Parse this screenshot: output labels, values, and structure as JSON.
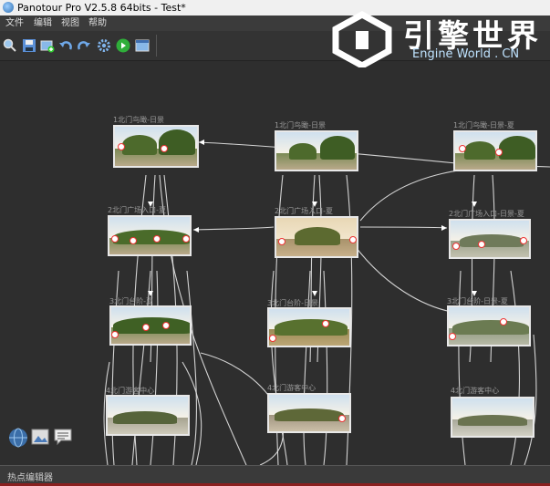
{
  "window": {
    "title": "Panotour Pro V2.5.8 64bits - Test*"
  },
  "menu": [
    "文件",
    "编辑",
    "视图",
    "帮助"
  ],
  "toolbar": [
    {
      "icon": "magnify-icon"
    },
    {
      "icon": "save-icon"
    },
    {
      "icon": "add-panorama-icon"
    },
    {
      "icon": "undo-icon"
    },
    {
      "icon": "redo-icon"
    },
    {
      "icon": "settings-gear-icon"
    },
    {
      "icon": "play-build-icon"
    },
    {
      "icon": "preview-window-icon"
    }
  ],
  "watermark": {
    "cn": "引擎世界",
    "en": "Engine World . CN"
  },
  "nodes": [
    {
      "label": "1北门鸟瞰-日景"
    },
    {
      "label": "1北门鸟瞰-日景"
    },
    {
      "label": "1北门鸟瞰-日景-夏"
    },
    {
      "label": "2北门广场入口-夏"
    },
    {
      "label": "2北门广场入口-夏"
    },
    {
      "label": "2北门广场入口-日景-夏"
    },
    {
      "label": "3北门台阶-夏"
    },
    {
      "label": "3北门台阶-日景"
    },
    {
      "label": "3北门台阶-日景-夏"
    },
    {
      "label": "4北门游客中心"
    },
    {
      "label": "4北门游客中心"
    },
    {
      "label": "4北门游客中心"
    }
  ],
  "bottom_icons": [
    {
      "icon": "globe-icon"
    },
    {
      "icon": "image-icon"
    },
    {
      "icon": "comment-icon"
    }
  ],
  "panel": {
    "label": "热点编辑器"
  }
}
